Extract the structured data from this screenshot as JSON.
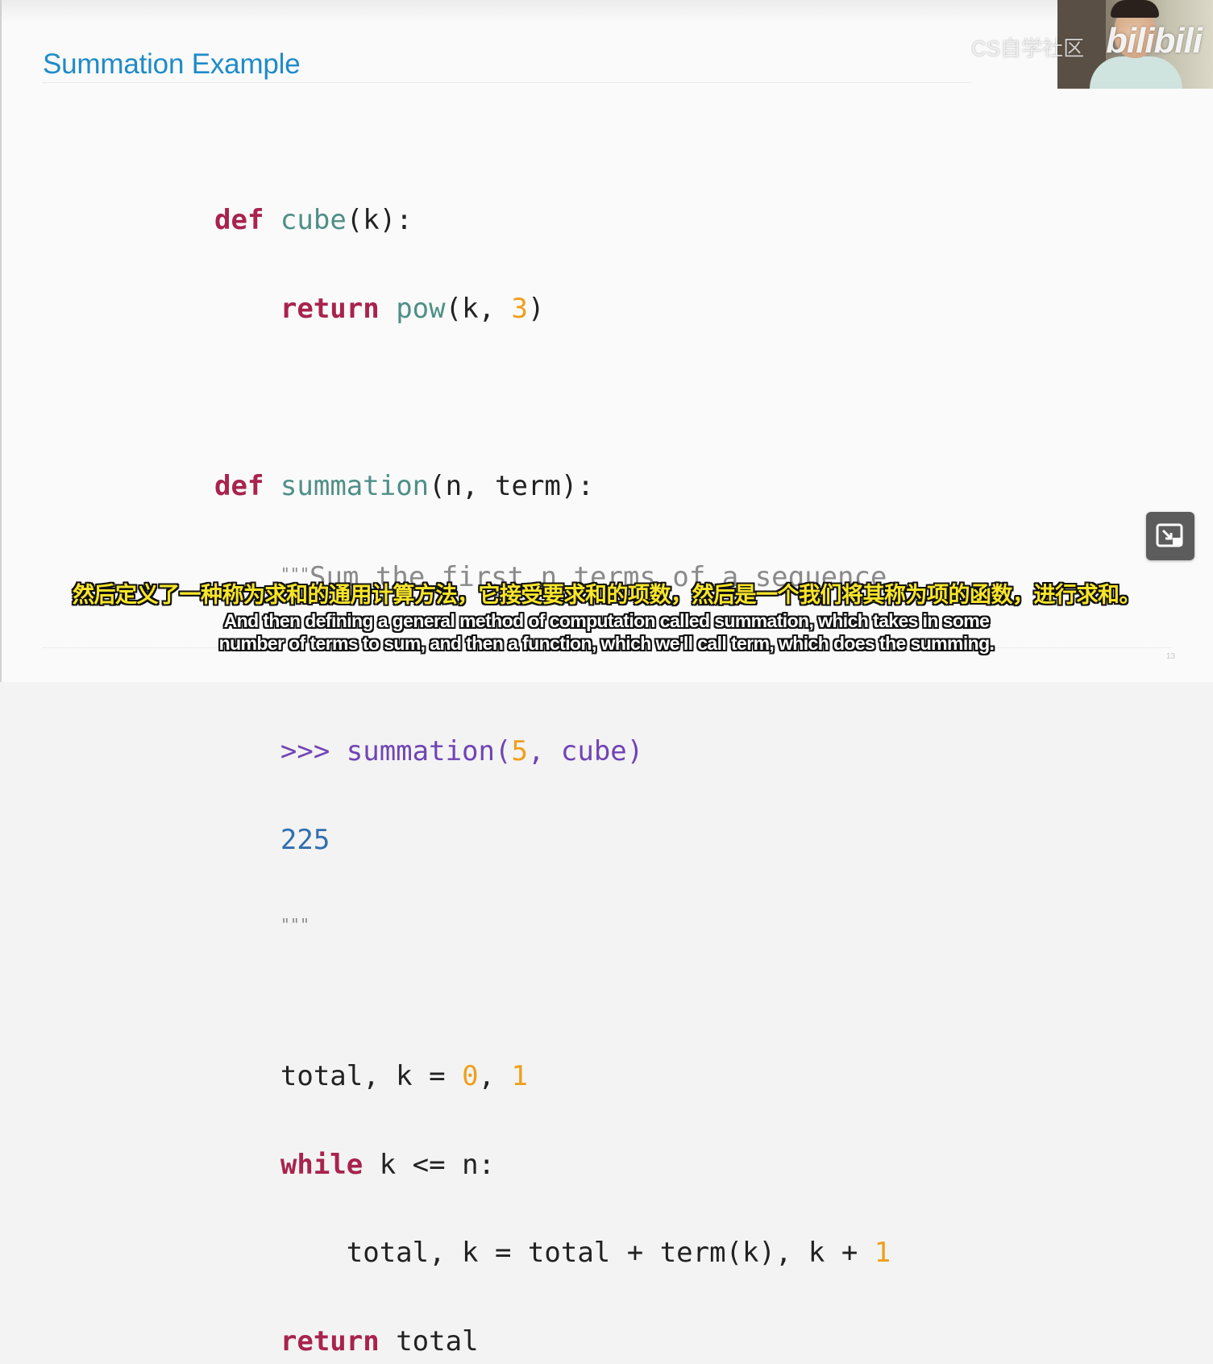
{
  "slide": {
    "title": "Summation Example",
    "page_number": "13"
  },
  "code": {
    "l1": {
      "kw": "def",
      "sp": " ",
      "fn": "cube",
      "rest": "(k):"
    },
    "l2": {
      "indent": "    ",
      "kw": "return",
      "sp": " ",
      "fn": "pow",
      "a": "(k, ",
      "num": "3",
      "b": ")"
    },
    "l3": {
      "kw": "def",
      "sp": " ",
      "fn": "summation",
      "rest": "(n, term):"
    },
    "l4": {
      "indent": "    ",
      "dq": "\"\"\"",
      "text": "Sum the first n terms of a sequence."
    },
    "l5": {
      "indent": "    ",
      "prompt": ">>> summation(",
      "num": "5",
      "prompt2": ", cube)"
    },
    "l6": {
      "indent": "    ",
      "out": "225"
    },
    "l7": {
      "indent": "    ",
      "dq": "\"\"\""
    },
    "l8": {
      "indent": "    ",
      "a": "total, k = ",
      "num1": "0",
      "b": ", ",
      "num2": "1"
    },
    "l9": {
      "indent": "    ",
      "kw": "while",
      "rest": " k <= n:"
    },
    "l10": {
      "indent": "        ",
      "a": "total, k = total + term(k), k + ",
      "num": "1"
    },
    "l11": {
      "indent": "    ",
      "kw": "return",
      "rest": " total"
    }
  },
  "overlay": {
    "watermark_cs": "CS自学社区",
    "watermark_bili": "bilibili"
  },
  "subtitles": {
    "chinese": "然后定义了一种称为求和的通用计算方法，它接受要求和的项数，然后是一个我们将其称为项的函数，进行求和。",
    "english_line1": "And then defining a general method of computation called summation, which takes in some",
    "english_line2": "number of terms to sum, and then a function, which we'll call term, which does the summing."
  },
  "icons": {
    "pip": "picture-in-picture-exit-icon"
  },
  "colors": {
    "title": "#1f8bc8",
    "keyword": "#a8234d",
    "function": "#4f8f87",
    "number": "#ef9f1b",
    "prompt": "#7044b4",
    "subtitle_cn": "#f7e52a"
  }
}
